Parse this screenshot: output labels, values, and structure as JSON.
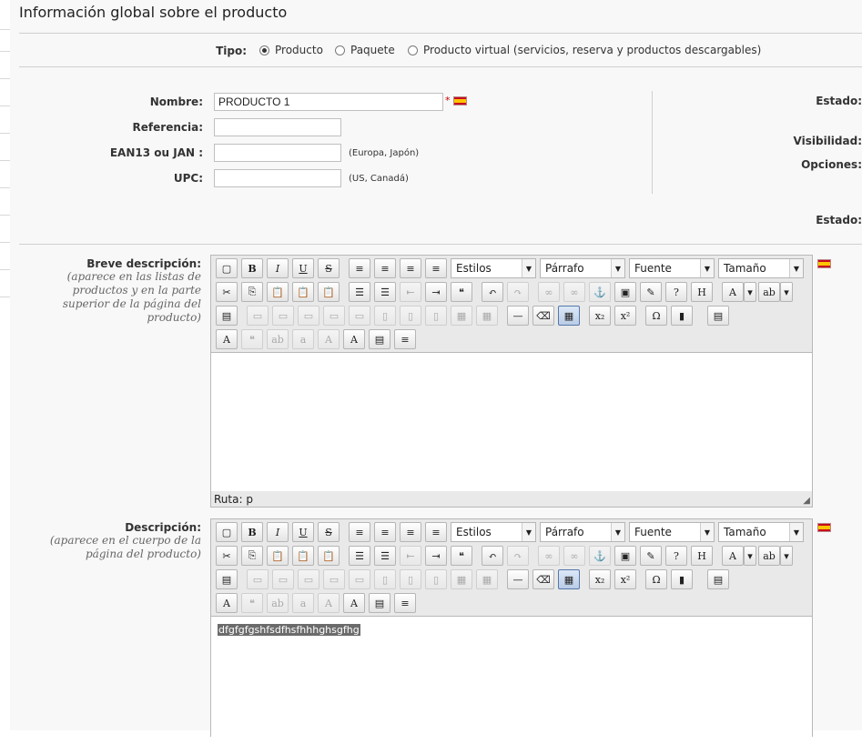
{
  "page": {
    "title": "Información global sobre el producto"
  },
  "tipo": {
    "label": "Tipo:",
    "options": [
      "Producto",
      "Paquete",
      "Producto virtual (servicios, reserva y productos descargables)"
    ],
    "selected": 0
  },
  "form": {
    "nombre_label": "Nombre:",
    "nombre_value": "PRODUCTO 1",
    "required_mark": "*",
    "referencia_label": "Referencia:",
    "referencia_value": "",
    "ean_label": "EAN13 ou JAN :",
    "ean_value": "",
    "ean_hint": "(Europa, Japón)",
    "upc_label": "UPC:",
    "upc_value": "",
    "upc_hint": "(US, Canadá)"
  },
  "right": {
    "estado1": "Estado:",
    "visibilidad": "Visibilidad:",
    "opciones": "Opciones:",
    "estado2": "Estado:"
  },
  "short_desc": {
    "label": "Breve descripción:",
    "hint": "(aparece en las listas de productos y en la parte superior de la página del producto)",
    "path": "Ruta: p",
    "content": ""
  },
  "desc": {
    "label": "Descripción:",
    "hint": "(aparece en el cuerpo de la página del producto)",
    "content": "dfgfgfgshfsdfhsfhhhghsgfhg"
  },
  "toolbar": {
    "styles": "Estilos",
    "format": "Párrafo",
    "font": "Fuente",
    "size": "Tamaño"
  },
  "colors": {
    "accent": "#5577aa",
    "flag_red": "#c60b1e",
    "flag_yellow": "#ffc400"
  }
}
